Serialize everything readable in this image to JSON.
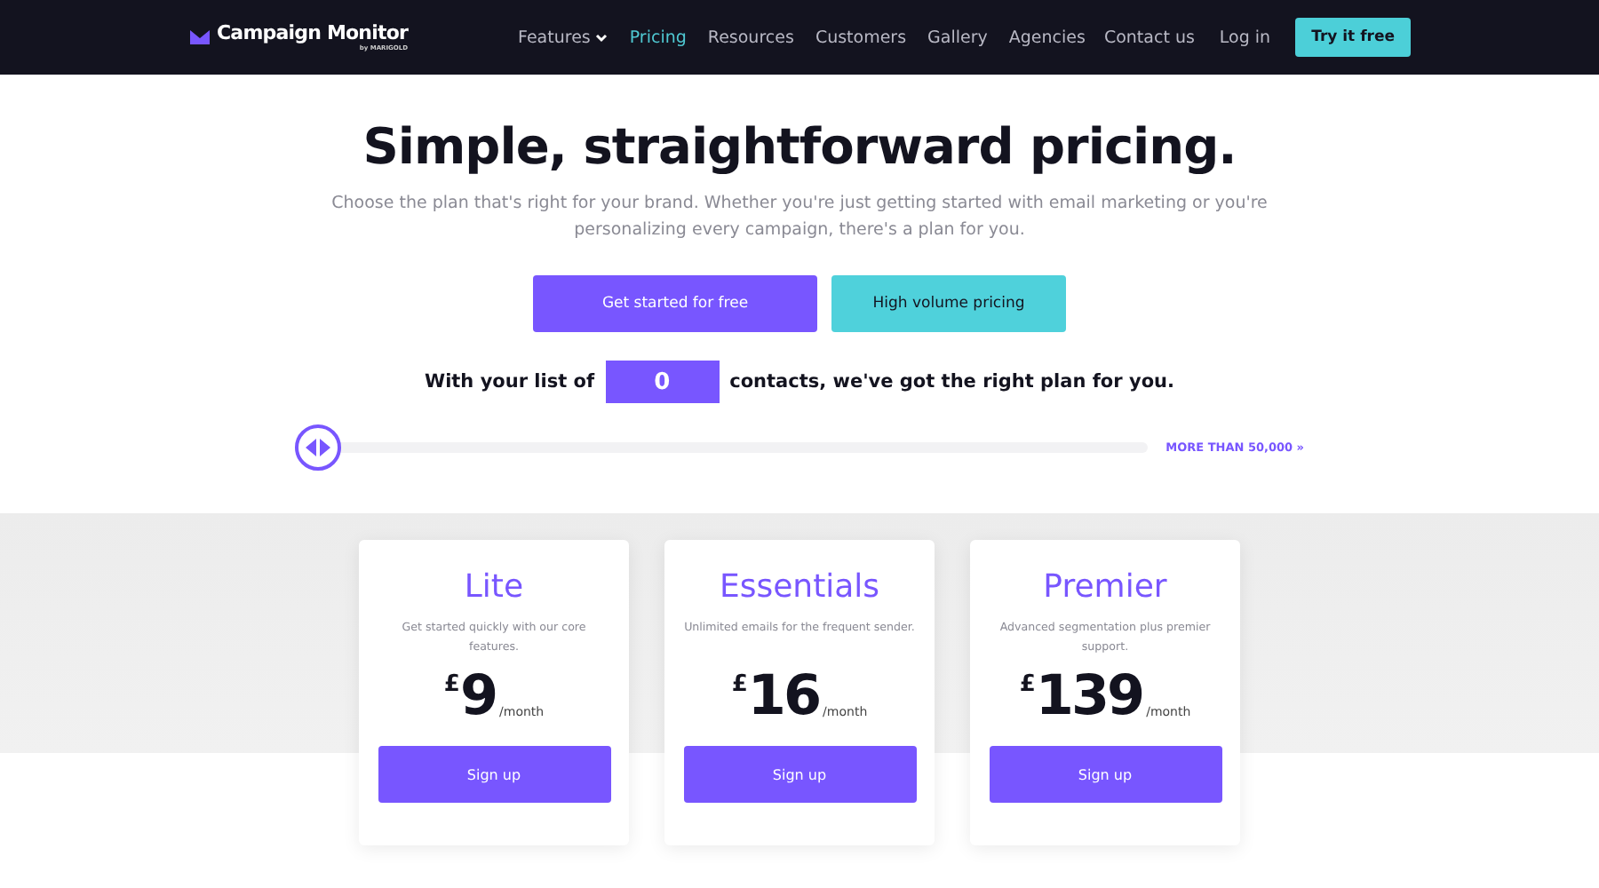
{
  "header": {
    "logo": "Campaign Monitor",
    "logo_sub": "by MARIGOLD",
    "nav": [
      {
        "label": "Features",
        "selected": false,
        "dropdown": true
      },
      {
        "label": "Pricing",
        "selected": true,
        "dropdown": false
      },
      {
        "label": "Resources",
        "selected": false,
        "dropdown": false
      },
      {
        "label": "Customers",
        "selected": false,
        "dropdown": false
      },
      {
        "label": "Gallery",
        "selected": false,
        "dropdown": false
      },
      {
        "label": "Agencies",
        "selected": false,
        "dropdown": false
      }
    ],
    "links": [
      "Contact us",
      "Log in"
    ],
    "cta": "Try it free"
  },
  "hero": {
    "title": "Simple, straightforward pricing.",
    "subtitle": "Choose the plan that's right for your brand. Whether you're just getting started with email marketing or you're personalizing every campaign, there's a plan for you.",
    "buttons": [
      {
        "label": "Get started for free",
        "kind": "primary"
      },
      {
        "label": "High volume pricing",
        "kind": "secondary"
      }
    ]
  },
  "contacts": {
    "before": "With your list of",
    "value": "0",
    "after": "contacts, we've got the right plan for you.",
    "slider": {
      "level": 0
    },
    "more_link": "MORE THAN 50,000 »"
  },
  "plans": [
    {
      "name": "Lite",
      "description": "Get started quickly with our core features.",
      "currency": "£",
      "price": "9",
      "period": "/month",
      "button": "Sign up"
    },
    {
      "name": "Essentials",
      "description": "Unlimited emails for the frequent sender.",
      "currency": "£",
      "price": "16",
      "period": "/month",
      "button": "Sign up"
    },
    {
      "name": "Premier",
      "description": "Advanced segmentation plus premier support.",
      "currency": "£",
      "price": "139",
      "period": "/month",
      "button": "Sign up"
    }
  ]
}
